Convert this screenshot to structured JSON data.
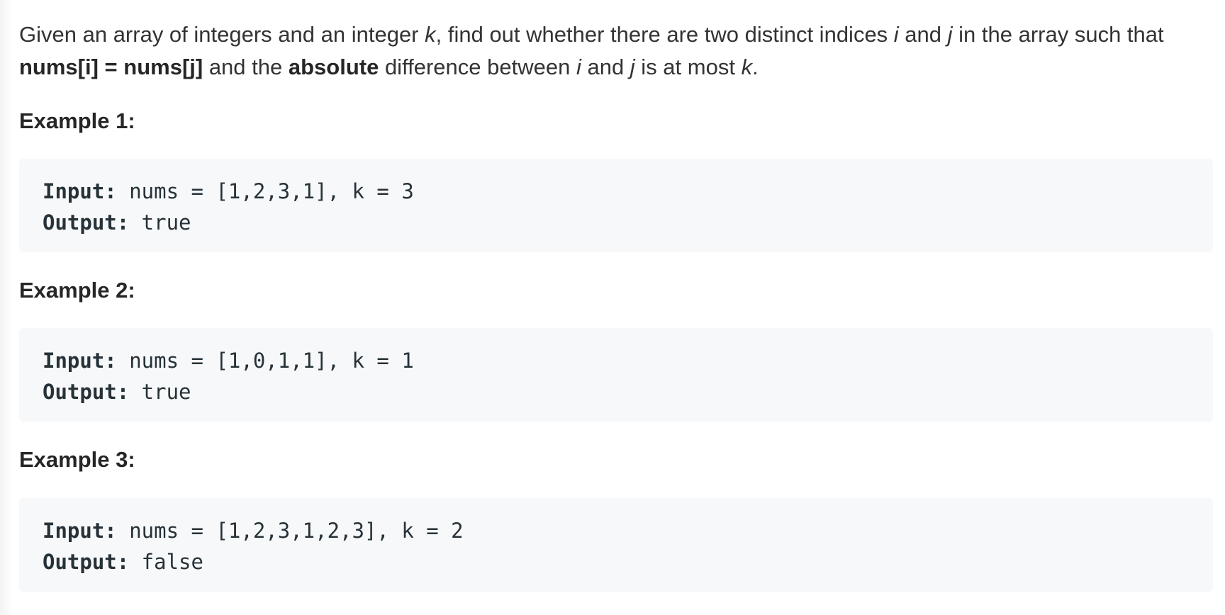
{
  "description": {
    "part1": "Given an array of integers and an integer ",
    "k1": "k",
    "part2": ", find out whether there are two distinct indices ",
    "i1": "i",
    "part3": " and ",
    "j1": "j",
    "part4": " in the array such that ",
    "cond": "nums[i] = nums[j]",
    "part5": " and the ",
    "absolute": "absolute",
    "part6": " difference between ",
    "i2": "i",
    "part7": " and ",
    "j2": "j",
    "part8": " is at most ",
    "k2": "k",
    "part9": "."
  },
  "examples": [
    {
      "title": "Example 1:",
      "input_label": "Input:",
      "input_value": " nums = [1,2,3,1], k = 3",
      "output_label": "Output:",
      "output_value": " true"
    },
    {
      "title": "Example 2:",
      "input_label": "Input:",
      "input_value": " nums = [1,0,1,1], k = 1",
      "output_label": "Output:",
      "output_value": " true"
    },
    {
      "title": "Example 3:",
      "input_label": "Input:",
      "input_value": " nums = [1,2,3,1,2,3], k = 2",
      "output_label": "Output:",
      "output_value": " false"
    }
  ]
}
